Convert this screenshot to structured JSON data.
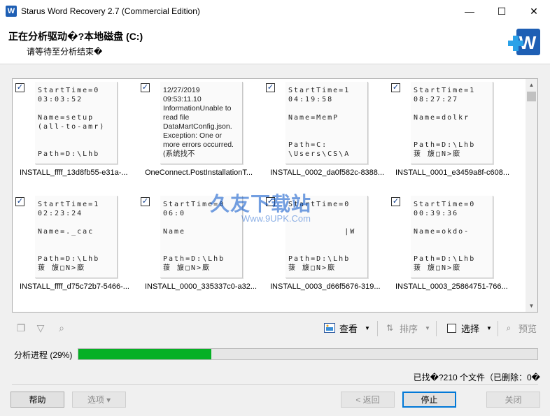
{
  "window": {
    "title": "Starus Word Recovery 2.7 (Commercial Edition)",
    "minimize": "—",
    "maximize": "☐",
    "close": "✕"
  },
  "header": {
    "title": "正在分析驱动�?本地磁盘 (C:)",
    "subtitle": "请等待至分析结束�"
  },
  "files": [
    {
      "checked": true,
      "preview": "StartTime=0\n03:03:52\n\nName=setup\n(all-to-amr)\n\n\nPath=D:\\Lhb",
      "name": "INSTALL_ffff_13d8fb55-e31a-..."
    },
    {
      "checked": true,
      "preview": "12/27/2019 09:53:11.10 InformationUnable to read file DataMartConfig.json. Exception: One or more errors occurred. (系统找不",
      "name": "OneConnect.PostInstallationT..."
    },
    {
      "checked": true,
      "preview": "StartTime=1\n04:19:58\n\nName=MemP\n\n\nPath=C:\n\\Users\\CS\\A",
      "name": "INSTALL_0002_da0f582c-8388..."
    },
    {
      "checked": true,
      "preview": "StartTime=1\n08:27:27\n\nName=dolkr\n\n\nPath=D:\\Lhb\n菝 旇□N>廞",
      "name": "INSTALL_0001_e3459a8f-c608..."
    },
    {
      "checked": true,
      "preview": "StartTime=1\n02:23:24\n\nName=._cac\n\n\nPath=D:\\Lhb\n菝 旇□N>廞",
      "name": "INSTALL_ffff_d75c72b7-5466-..."
    },
    {
      "checked": true,
      "preview": "StartTime=0\n06:0\n\nName\n\n\nPath=D:\\Lhb\n菝 旇□N>廞",
      "name": "INSTALL_0000_335337c0-a32..."
    },
    {
      "checked": true,
      "preview": "StartTime=0\n\n\n          |W\n\n\nPath=D:\\Lhb\n菝 旇□N>廞",
      "name": "INSTALL_0003_d66f5676-319..."
    },
    {
      "checked": true,
      "preview": "StartTime=0\n00:39:36\n\nName=okdo-\n\n\nPath=D:\\Lhb\n菝 旇□N>廞",
      "name": "INSTALL_0003_25864751-766..."
    }
  ],
  "watermark": {
    "text": "久友下载站",
    "url": "Www.9UPK.Com"
  },
  "toolbar": {
    "view_label": "查看",
    "sort_label": "排序",
    "select_label": "选择",
    "preview_label": "预览"
  },
  "progress": {
    "label": "分析进程 (29%)",
    "percent": 29
  },
  "status_text": "已找�?210 个文件（已删除：0�",
  "buttons": {
    "help": "帮助",
    "options": "选项 ▾",
    "back": "< 返回",
    "stop": "停止",
    "close": "关闭"
  },
  "colors": {
    "progress": "#06b025",
    "accent": "#0078d7",
    "brand": "#1e5fb4"
  }
}
